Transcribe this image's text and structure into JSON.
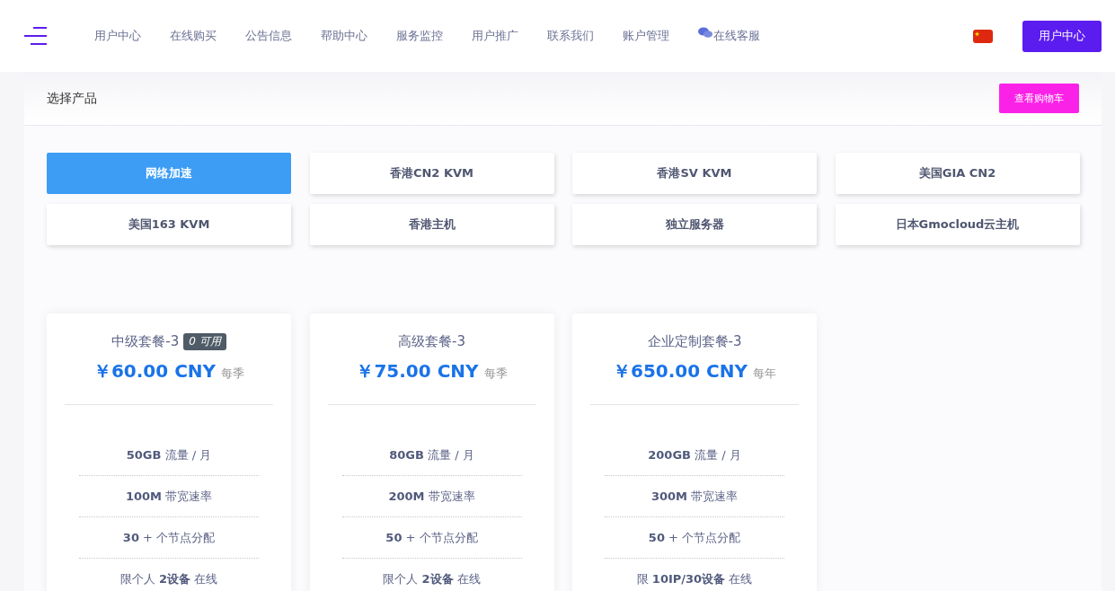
{
  "nav": {
    "items": [
      {
        "label": "用户中心",
        "icon": false
      },
      {
        "label": "在线购买",
        "icon": false
      },
      {
        "label": "公告信息",
        "icon": false
      },
      {
        "label": "帮助中心",
        "icon": false
      },
      {
        "label": "服务监控",
        "icon": false
      },
      {
        "label": "用户推广",
        "icon": false
      },
      {
        "label": "联系我们",
        "icon": false
      },
      {
        "label": "账户管理",
        "icon": false
      },
      {
        "label": "在线客服",
        "icon": true
      }
    ],
    "user_button": "用户中心"
  },
  "panel": {
    "title": "选择产品",
    "cart_button": "查看购物车"
  },
  "categories": [
    {
      "label": "网络加速",
      "selected": true
    },
    {
      "label": "香港CN2 KVM",
      "selected": false
    },
    {
      "label": "香港SV KVM",
      "selected": false
    },
    {
      "label": "美国GIA CN2",
      "selected": false
    },
    {
      "label": "美国163 KVM",
      "selected": false
    },
    {
      "label": "香港主机",
      "selected": false
    },
    {
      "label": "独立服务器",
      "selected": false
    },
    {
      "label": "日本Gmocloud云主机",
      "selected": false
    }
  ],
  "plans": [
    {
      "name": "中级套餐-3",
      "badge": "0 可用",
      "price": "￥60.00 CNY",
      "period": "每季",
      "features": [
        "**50GB** 流量 / 月",
        "**100M** 带宽速率",
        "**30** + 个节点分配",
        "限个人 **2设备** 在线"
      ]
    },
    {
      "name": "高级套餐-3",
      "price": "￥75.00 CNY",
      "period": "每季",
      "features": [
        "**80GB** 流量 / 月",
        "**200M** 带宽速率",
        "**50** + 个节点分配",
        "限个人 **2设备** 在线"
      ]
    },
    {
      "name": "企业定制套餐-3",
      "price": "￥650.00 CNY",
      "period": "每年",
      "features": [
        "**200GB** 流量 / 月",
        "**300M** 带宽速率",
        "**50** + 个节点分配",
        "限 **10IP/30设备** 在线"
      ]
    }
  ]
}
